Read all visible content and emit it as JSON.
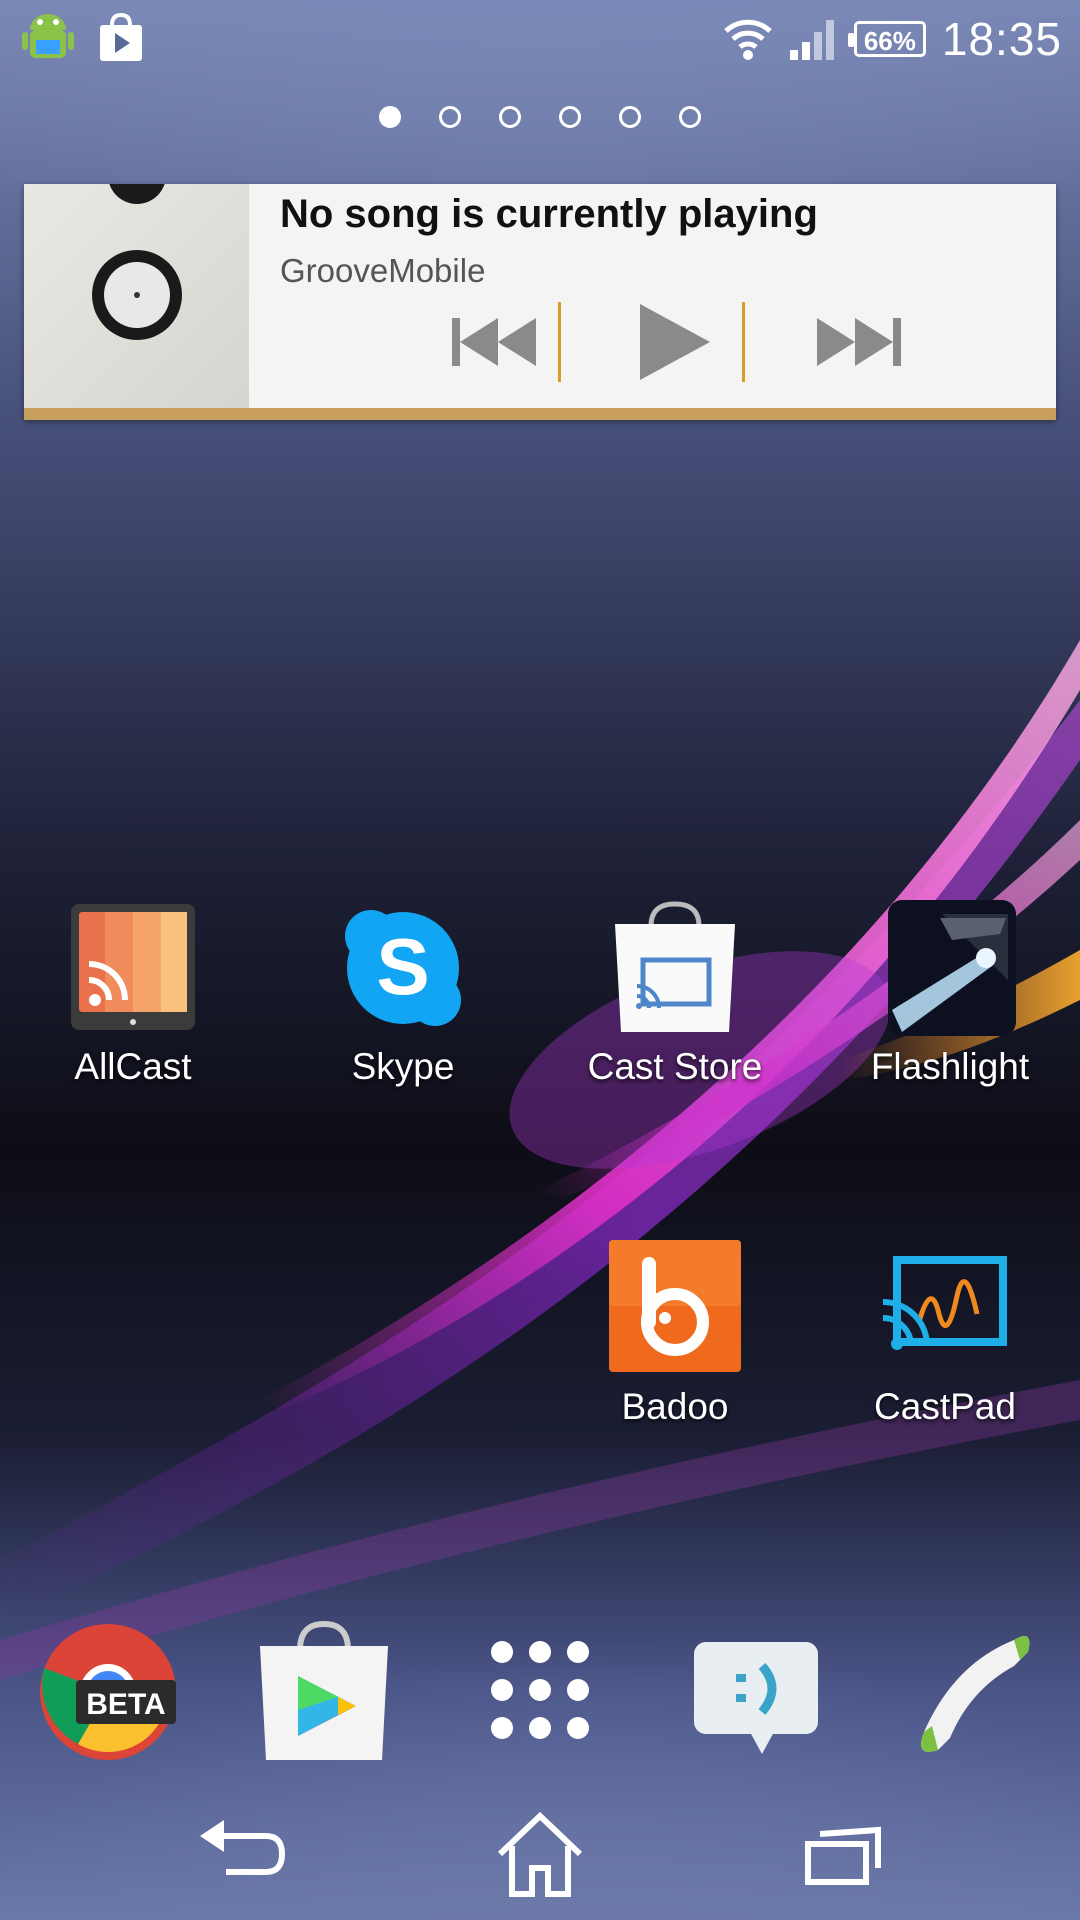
{
  "status_bar": {
    "left_icons": [
      "android-debug-icon",
      "play-store-notification-icon"
    ],
    "battery_percent": "66%",
    "time": "18:35"
  },
  "home_pages": {
    "count": 6,
    "active_index": 0
  },
  "music_widget": {
    "title": "No song is currently playing",
    "app_name": "GrooveMobile",
    "controls": [
      "previous-icon",
      "play-icon",
      "next-icon"
    ],
    "accent_color": "#c9a05b"
  },
  "apps": [
    {
      "label": "AllCast"
    },
    {
      "label": "Skype"
    },
    {
      "label": "Cast Store"
    },
    {
      "label": "Flashlight"
    },
    {
      "label": "Badoo"
    },
    {
      "label": "CastPad"
    }
  ],
  "dock": {
    "items": [
      "chrome-beta-icon",
      "play-store-icon",
      "app-drawer-icon",
      "messaging-icon",
      "phone-icon"
    ],
    "chrome_badge": "BETA"
  },
  "nav_bar": [
    "back-icon",
    "home-icon",
    "recent-apps-icon"
  ]
}
